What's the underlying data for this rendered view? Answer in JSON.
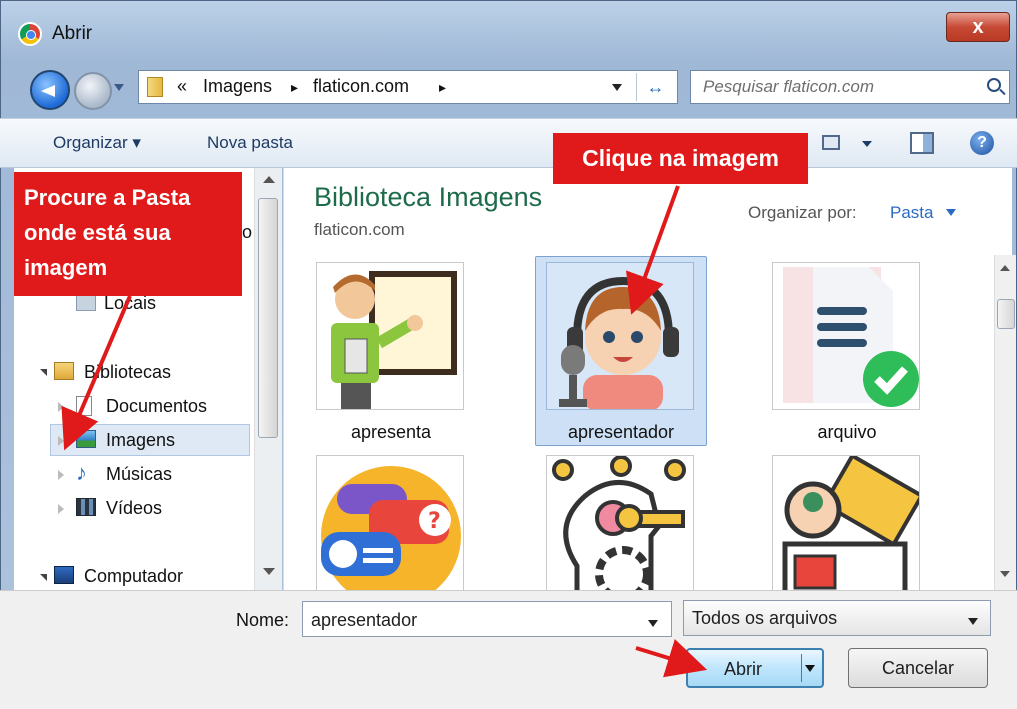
{
  "window": {
    "title": "Abrir",
    "close_glyph": "x"
  },
  "address_bar": {
    "overflow": "«",
    "crumbs": [
      "Imagens",
      "flaticon.com"
    ],
    "separator": "▸",
    "refresh_glyph": "↔"
  },
  "search": {
    "placeholder": "Pesquisar flaticon.com"
  },
  "toolbar": {
    "organize_label": "Organizar ▾",
    "new_folder_label": "Nova pasta",
    "help_glyph": "?"
  },
  "nav": {
    "items": [
      {
        "label": "Locais",
        "icon": "locations-icon"
      },
      {
        "label": "Bibliotecas",
        "icon": "libraries-icon"
      },
      {
        "label": "Documentos",
        "icon": "documents-icon"
      },
      {
        "label": "Imagens",
        "icon": "pictures-icon",
        "selected": true
      },
      {
        "label": "Músicas",
        "icon": "music-icon"
      },
      {
        "label": "Vídeos",
        "icon": "videos-icon"
      },
      {
        "label": "Computador",
        "icon": "computer-icon"
      }
    ],
    "partial_fragment": "o"
  },
  "library": {
    "title": "Biblioteca Imagens",
    "subtitle": "flaticon.com",
    "sort_label": "Organizar por:",
    "sort_value": "Pasta"
  },
  "files": [
    {
      "label": "apresenta",
      "icon": "teacher-icon"
    },
    {
      "label": "apresentador",
      "icon": "presenter-headset-icon",
      "selected": true
    },
    {
      "label": "arquivo",
      "icon": "file-check-icon"
    },
    {
      "label": "",
      "icon": "chat-bubbles-icon"
    },
    {
      "label": "",
      "icon": "mind-key-icon"
    },
    {
      "label": "",
      "icon": "profile-document-icon"
    }
  ],
  "footer": {
    "name_label": "Nome:",
    "name_value": "apresentador",
    "filetype_value": "Todos os arquivos",
    "open_label": "Abrir",
    "cancel_label": "Cancelar"
  },
  "annotations": {
    "callout_left": [
      "Procure a Pasta",
      "onde está sua",
      "imagem"
    ],
    "callout_top": "Clique na imagem",
    "color": "#e01a1a"
  },
  "colors": {
    "selection": "#cde0f6",
    "library_title": "#1e6b4a",
    "link": "#2a6bc2"
  }
}
